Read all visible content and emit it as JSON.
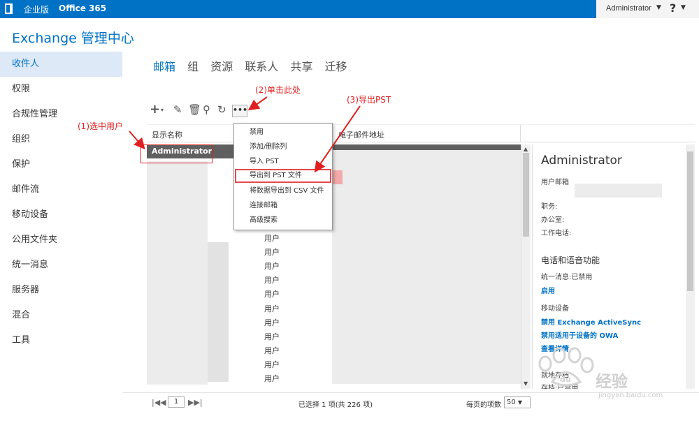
{
  "topbar": {
    "enterprise": "企业版",
    "office365": "Office 365",
    "user": "Administrator",
    "help": "?",
    "logo_icon": "office-logo-icon"
  },
  "app_title": "Exchange 管理中心",
  "nav": [
    "收件人",
    "权限",
    "合规性管理",
    "组织",
    "保护",
    "邮件流",
    "移动设备",
    "公用文件夹",
    "统一消息",
    "服务器",
    "混合",
    "工具"
  ],
  "tabs": [
    "邮箱",
    "组",
    "资源",
    "联系人",
    "共享",
    "迁移"
  ],
  "toolbar": {
    "add_icon": "plus-icon",
    "edit_icon": "pencil-icon",
    "delete_icon": "trash-icon",
    "search_icon": "search-icon",
    "refresh_icon": "refresh-icon",
    "more_label": "•••"
  },
  "grid": {
    "col_display_name": "显示名称",
    "col_email": "电子邮件地址",
    "selected_row": "Administrator",
    "mailbox_type": "用户",
    "status": "已选择 1 项(共 226 项)",
    "page": "1",
    "per_page_label": "每页的项数",
    "per_page": "50"
  },
  "menu": [
    "禁用",
    "添加/删除列",
    "导入 PST",
    "导出到 PST 文件",
    "将数据导出到 CSV 文件",
    "连接邮箱",
    "高级搜索"
  ],
  "detail": {
    "name": "Administrator",
    "user_mailbox": "用户邮箱",
    "title_label": "职务:",
    "office_label": "办公室:",
    "work_phone_label": "工作电话:",
    "phone_voice": "电话和语音功能",
    "um_status": "统一消息:已禁用",
    "enable": "启用",
    "mobile_devices": "移动设备",
    "disable_eas": "禁用 Exchange ActiveSync",
    "disable_owa": "禁用适用于设备的 OWA",
    "view_details": "查看详情",
    "in_place_archive": "就地存档",
    "archive_status": "存档:已禁用"
  },
  "annotations": {
    "step1": "(1)选中用户",
    "step2": "(2)单击此处",
    "step3": "(3)导出PST",
    "color": "#e02020"
  },
  "watermark": {
    "text": "经验",
    "url": "jingyan.baidu.com"
  }
}
